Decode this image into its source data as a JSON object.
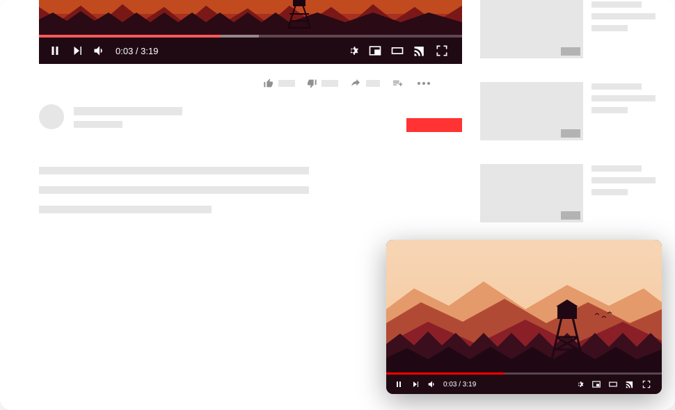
{
  "player": {
    "current_time": "0:03",
    "duration": "3:19",
    "time_display": "0:03 / 3:19",
    "progress_played_pct": 43,
    "progress_buffered_pct": 52
  },
  "pip": {
    "current_time": "0:03",
    "duration": "3:19",
    "time_display": "0:03 / 3:19",
    "progress_played_pct": 43
  },
  "colors": {
    "accent": "#ff0000",
    "subscribe": "#ff3333",
    "placeholder": "#e6e6e6",
    "icon_gray": "#909090"
  },
  "icons": {
    "pause": "pause-icon",
    "next": "next-icon",
    "volume": "volume-icon",
    "settings": "gear-icon",
    "miniplayer": "miniplayer-icon",
    "theater": "theater-icon",
    "cast": "cast-icon",
    "fullscreen": "fullscreen-icon",
    "like": "thumbs-up-icon",
    "dislike": "thumbs-down-icon",
    "share": "share-icon",
    "save": "playlist-add-icon",
    "more": "more-icon"
  }
}
